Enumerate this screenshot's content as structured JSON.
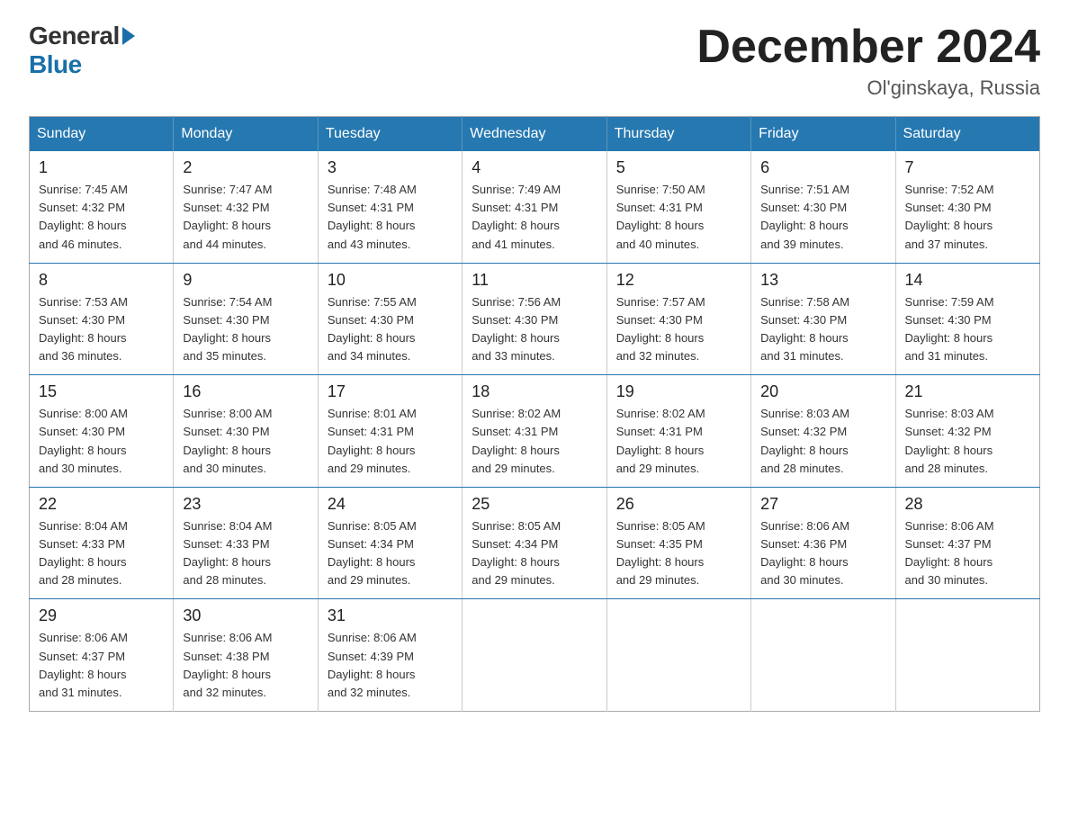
{
  "logo": {
    "text_general": "General",
    "text_blue": "Blue"
  },
  "header": {
    "month_year": "December 2024",
    "location": "Ol'ginskaya, Russia"
  },
  "weekdays": [
    "Sunday",
    "Monday",
    "Tuesday",
    "Wednesday",
    "Thursday",
    "Friday",
    "Saturday"
  ],
  "weeks": [
    [
      {
        "day": "1",
        "sunrise": "7:45 AM",
        "sunset": "4:32 PM",
        "daylight": "8 hours and 46 minutes."
      },
      {
        "day": "2",
        "sunrise": "7:47 AM",
        "sunset": "4:32 PM",
        "daylight": "8 hours and 44 minutes."
      },
      {
        "day": "3",
        "sunrise": "7:48 AM",
        "sunset": "4:31 PM",
        "daylight": "8 hours and 43 minutes."
      },
      {
        "day": "4",
        "sunrise": "7:49 AM",
        "sunset": "4:31 PM",
        "daylight": "8 hours and 41 minutes."
      },
      {
        "day": "5",
        "sunrise": "7:50 AM",
        "sunset": "4:31 PM",
        "daylight": "8 hours and 40 minutes."
      },
      {
        "day": "6",
        "sunrise": "7:51 AM",
        "sunset": "4:30 PM",
        "daylight": "8 hours and 39 minutes."
      },
      {
        "day": "7",
        "sunrise": "7:52 AM",
        "sunset": "4:30 PM",
        "daylight": "8 hours and 37 minutes."
      }
    ],
    [
      {
        "day": "8",
        "sunrise": "7:53 AM",
        "sunset": "4:30 PM",
        "daylight": "8 hours and 36 minutes."
      },
      {
        "day": "9",
        "sunrise": "7:54 AM",
        "sunset": "4:30 PM",
        "daylight": "8 hours and 35 minutes."
      },
      {
        "day": "10",
        "sunrise": "7:55 AM",
        "sunset": "4:30 PM",
        "daylight": "8 hours and 34 minutes."
      },
      {
        "day": "11",
        "sunrise": "7:56 AM",
        "sunset": "4:30 PM",
        "daylight": "8 hours and 33 minutes."
      },
      {
        "day": "12",
        "sunrise": "7:57 AM",
        "sunset": "4:30 PM",
        "daylight": "8 hours and 32 minutes."
      },
      {
        "day": "13",
        "sunrise": "7:58 AM",
        "sunset": "4:30 PM",
        "daylight": "8 hours and 31 minutes."
      },
      {
        "day": "14",
        "sunrise": "7:59 AM",
        "sunset": "4:30 PM",
        "daylight": "8 hours and 31 minutes."
      }
    ],
    [
      {
        "day": "15",
        "sunrise": "8:00 AM",
        "sunset": "4:30 PM",
        "daylight": "8 hours and 30 minutes."
      },
      {
        "day": "16",
        "sunrise": "8:00 AM",
        "sunset": "4:30 PM",
        "daylight": "8 hours and 30 minutes."
      },
      {
        "day": "17",
        "sunrise": "8:01 AM",
        "sunset": "4:31 PM",
        "daylight": "8 hours and 29 minutes."
      },
      {
        "day": "18",
        "sunrise": "8:02 AM",
        "sunset": "4:31 PM",
        "daylight": "8 hours and 29 minutes."
      },
      {
        "day": "19",
        "sunrise": "8:02 AM",
        "sunset": "4:31 PM",
        "daylight": "8 hours and 29 minutes."
      },
      {
        "day": "20",
        "sunrise": "8:03 AM",
        "sunset": "4:32 PM",
        "daylight": "8 hours and 28 minutes."
      },
      {
        "day": "21",
        "sunrise": "8:03 AM",
        "sunset": "4:32 PM",
        "daylight": "8 hours and 28 minutes."
      }
    ],
    [
      {
        "day": "22",
        "sunrise": "8:04 AM",
        "sunset": "4:33 PM",
        "daylight": "8 hours and 28 minutes."
      },
      {
        "day": "23",
        "sunrise": "8:04 AM",
        "sunset": "4:33 PM",
        "daylight": "8 hours and 28 minutes."
      },
      {
        "day": "24",
        "sunrise": "8:05 AM",
        "sunset": "4:34 PM",
        "daylight": "8 hours and 29 minutes."
      },
      {
        "day": "25",
        "sunrise": "8:05 AM",
        "sunset": "4:34 PM",
        "daylight": "8 hours and 29 minutes."
      },
      {
        "day": "26",
        "sunrise": "8:05 AM",
        "sunset": "4:35 PM",
        "daylight": "8 hours and 29 minutes."
      },
      {
        "day": "27",
        "sunrise": "8:06 AM",
        "sunset": "4:36 PM",
        "daylight": "8 hours and 30 minutes."
      },
      {
        "day": "28",
        "sunrise": "8:06 AM",
        "sunset": "4:37 PM",
        "daylight": "8 hours and 30 minutes."
      }
    ],
    [
      {
        "day": "29",
        "sunrise": "8:06 AM",
        "sunset": "4:37 PM",
        "daylight": "8 hours and 31 minutes."
      },
      {
        "day": "30",
        "sunrise": "8:06 AM",
        "sunset": "4:38 PM",
        "daylight": "8 hours and 32 minutes."
      },
      {
        "day": "31",
        "sunrise": "8:06 AM",
        "sunset": "4:39 PM",
        "daylight": "8 hours and 32 minutes."
      },
      null,
      null,
      null,
      null
    ]
  ],
  "labels": {
    "sunrise": "Sunrise:",
    "sunset": "Sunset:",
    "daylight": "Daylight:"
  }
}
